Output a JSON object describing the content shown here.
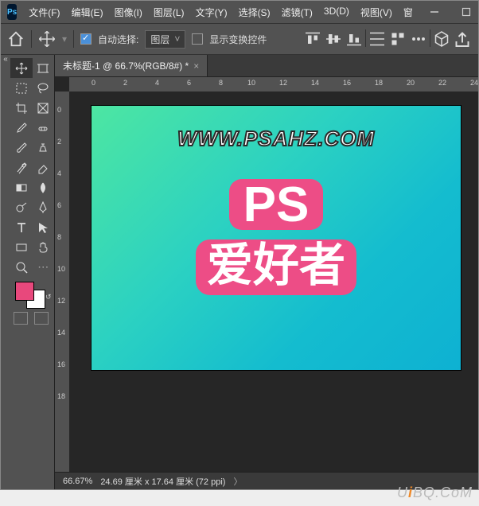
{
  "app": {
    "logo_text": "Ps"
  },
  "menu": {
    "file": "文件(F)",
    "edit": "编辑(E)",
    "image": "图像(I)",
    "layer": "图层(L)",
    "type": "文字(Y)",
    "select": "选择(S)",
    "filter": "滤镜(T)",
    "threeD": "3D(D)",
    "view": "视图(V)",
    "window": "窗"
  },
  "options": {
    "auto_select_label": "自动选择:",
    "auto_select_checked": true,
    "target_dropdown": "图层",
    "show_transform_label": "显示变换控件",
    "show_transform_checked": false
  },
  "tab": {
    "title": "未标题-1 @ 66.7%(RGB/8#) *"
  },
  "ruler_h": [
    "0",
    "2",
    "4",
    "6",
    "8",
    "10",
    "12",
    "14",
    "16",
    "18",
    "20",
    "22",
    "24"
  ],
  "ruler_v": [
    "0",
    "2",
    "4",
    "6",
    "8",
    "10",
    "12",
    "14",
    "16",
    "18"
  ],
  "canvas": {
    "url_text": "WWW.PSAHZ.COM",
    "big_text": "PS",
    "cn_text": "爱好者"
  },
  "status": {
    "zoom": "66.67%",
    "dims": "24.69 厘米 x 17.64 厘米 (72 ppi)"
  },
  "swatch": {
    "fg": "#e8487c",
    "bg": "#ffffff"
  },
  "watermark_prefix": "U",
  "watermark_mid": "i",
  "watermark_rest": "BQ.CoM"
}
